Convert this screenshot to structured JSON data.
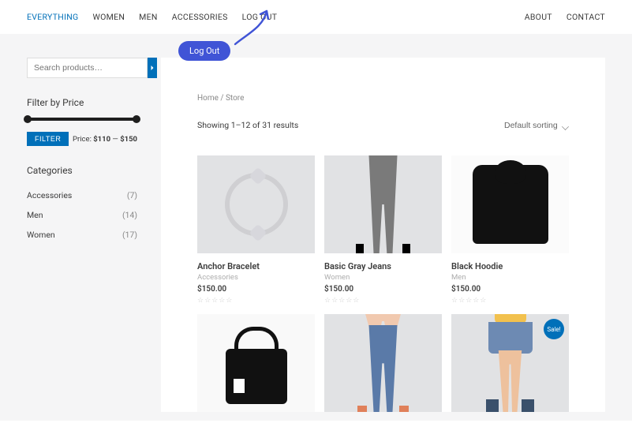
{
  "nav": {
    "left": [
      "EVERYTHING",
      "WOMEN",
      "MEN",
      "ACCESSORIES",
      "LOG OUT"
    ],
    "right": [
      "ABOUT",
      "CONTACT"
    ],
    "active_index": 0
  },
  "callout": {
    "label": "Log Out"
  },
  "search": {
    "placeholder": "Search products…"
  },
  "filter": {
    "title": "Filter by Price",
    "button": "FILTER",
    "price_prefix": "Price: ",
    "price_low": "$110",
    "price_sep": " — ",
    "price_high": "$150"
  },
  "categories": {
    "title": "Categories",
    "items": [
      {
        "label": "Accessories",
        "count": "(7)"
      },
      {
        "label": "Men",
        "count": "(14)"
      },
      {
        "label": "Women",
        "count": "(17)"
      }
    ]
  },
  "breadcrumb": "Home / Store",
  "results_text": "Showing 1–12 of 31 results",
  "sort": {
    "selected": "Default sorting"
  },
  "products_row1": [
    {
      "title": "Anchor Bracelet",
      "cat": "Accessories",
      "price": "$150.00"
    },
    {
      "title": "Basic Gray Jeans",
      "cat": "Women",
      "price": "$150.00"
    },
    {
      "title": "Black Hoodie",
      "cat": "Men",
      "price": "$150.00"
    }
  ],
  "sale_label": "Sale!",
  "stars": "☆☆☆☆☆"
}
